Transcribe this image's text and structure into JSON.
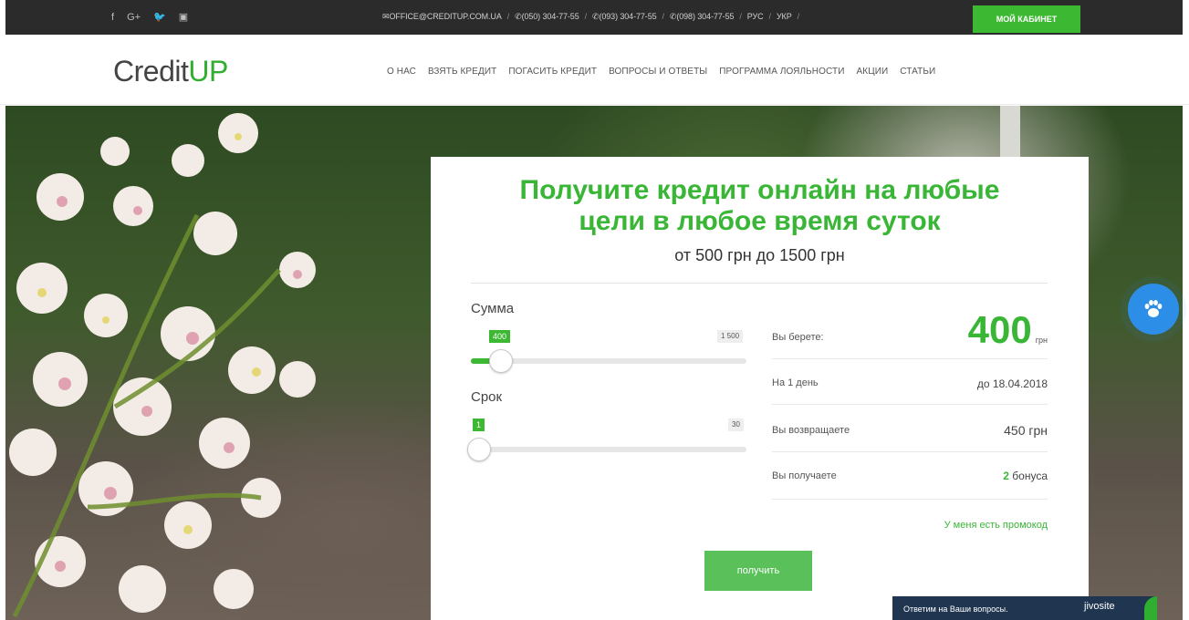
{
  "topbar": {
    "social": [
      {
        "icon": "facebook-icon",
        "glyph": "f"
      },
      {
        "icon": "google-plus-icon",
        "glyph": "G+"
      },
      {
        "icon": "twitter-icon",
        "glyph": "🐦"
      },
      {
        "icon": "youtube-icon",
        "glyph": "▣"
      }
    ],
    "email": "✉OFFICE@CREDITUP.COM.UA",
    "phones": [
      "✆(050) 304-77-55",
      "✆(093) 304-77-55",
      "✆(098) 304-77-55"
    ],
    "lang_ru": "РУС",
    "lang_uk": "УКР",
    "cabinet_label": "МОЙ КАБИНЕТ",
    "separator": "/"
  },
  "header": {
    "logo_main": "Credit",
    "logo_accent": "UP",
    "nav": [
      "О НАС",
      "ВЗЯТЬ КРЕДИТ",
      "ПОГАСИТЬ КРЕДИТ",
      "ВОПРОСЫ И ОТВЕТЫ",
      "ПРОГРАММА ЛОЯЛЬНОСТИ",
      "АКЦИИ",
      "СТАТЬИ"
    ]
  },
  "calculator": {
    "title_line1": "Получите кредит онлайн на любые",
    "title_line2": "цели в любое время суток",
    "subtitle": "от 500 грн до 1500 грн",
    "sum": {
      "label": "Сумма",
      "current": "400",
      "max": "1 500",
      "fraction": 0.08
    },
    "term": {
      "label": "Срок",
      "current": "1",
      "max": "30",
      "fraction": 0.0
    },
    "rows": {
      "take_label": "Вы берете:",
      "take_amount": "400",
      "take_unit": "грн",
      "days_label": "На 1 день",
      "days_value": "до 18.04.2018",
      "return_label": "Вы возвращаете",
      "return_value": "450 грн",
      "bonus_label": "Вы получаете",
      "bonus_count": "2",
      "bonus_word": "бонуса"
    },
    "promo_link": "У меня есть промокод",
    "submit_label": "получить"
  },
  "chat": {
    "message": "Ответим на Ваши вопросы.",
    "brand": "jivosite"
  },
  "colors": {
    "accent": "#3db833",
    "paw": "#2d8ee8",
    "topbar": "#2b2b2b"
  }
}
